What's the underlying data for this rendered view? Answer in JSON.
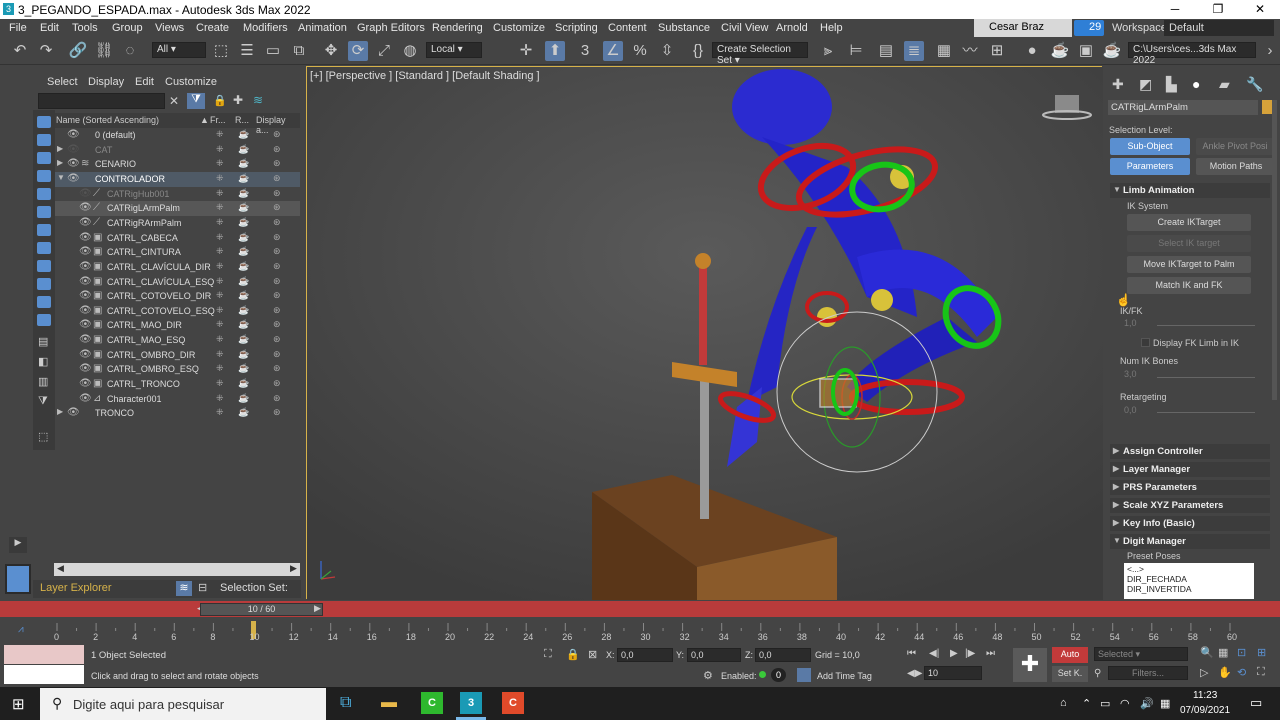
{
  "window": {
    "title": "3_PEGANDO_ESPADA.max - Autodesk 3ds Max 2022"
  },
  "menu": [
    "File",
    "Edit",
    "Tools",
    "Group",
    "Views",
    "Create",
    "Modifiers",
    "Animation",
    "Graph Editors",
    "Rendering",
    "Customize",
    "Scripting",
    "Content",
    "Substance",
    "Civil View",
    "Arnold",
    "Help"
  ],
  "account": {
    "user": "Cesar Braz",
    "badge": "29",
    "workspaces_label": "Workspaces:",
    "workspace": "Default"
  },
  "toolbar": {
    "filter": "All",
    "coord": "Local",
    "selection_set": "Create Selection Set",
    "path": "C:\\Users\\ces...3ds Max 2022"
  },
  "explorer": {
    "tabs": [
      "Select",
      "Display",
      "Edit",
      "Customize"
    ],
    "columns": {
      "name": "Name (Sorted Ascending)",
      "fr": "Fr...",
      "r": "R...",
      "display": "Display a..."
    },
    "rows": [
      {
        "name": "0 (default)"
      },
      {
        "name": "CAT"
      },
      {
        "name": "CENARIO"
      },
      {
        "name": "CONTROLADOR"
      },
      {
        "name": "CATRigHub001"
      },
      {
        "name": "CATRigLArmPalm"
      },
      {
        "name": "CATRigRArmPalm"
      },
      {
        "name": "CATRL_CABECA"
      },
      {
        "name": "CATRL_CINTURA"
      },
      {
        "name": "CATRL_CLAVÍCULA_DIR"
      },
      {
        "name": "CATRL_CLAVÍCULA_ESQ"
      },
      {
        "name": "CATRL_COTOVELO_DIR"
      },
      {
        "name": "CATRL_COTOVELO_ESQ"
      },
      {
        "name": "CATRL_MAO_DIR"
      },
      {
        "name": "CATRL_MAO_ESQ"
      },
      {
        "name": "CATRL_OMBRO_DIR"
      },
      {
        "name": "CATRL_OMBRO_ESQ"
      },
      {
        "name": "CATRL_TRONCO"
      },
      {
        "name": "Character001"
      },
      {
        "name": "TRONCO"
      }
    ],
    "layer_explorer": "Layer Explorer",
    "selection_set": "Selection Set:"
  },
  "viewport": {
    "label": "[+] [Perspective ] [Standard ] [Default Shading ]"
  },
  "cmd": {
    "object_name": "CATRigLArmPalm",
    "selection_level": "Selection Level:",
    "sub_object": "Sub-Object",
    "ankle_pivot": "Ankle Pivot Posi",
    "parameters": "Parameters",
    "motion_paths": "Motion Paths",
    "limb_animation": "Limb Animation",
    "ik_system": "IK System",
    "create_iktarget": "Create IKTarget",
    "select_iktarget": "Select IK target",
    "move_iktarget": "Move IKTarget to Palm",
    "match_ik_fk": "Match IK and FK",
    "ikfk": "IK/FK",
    "ikfk_val": "1,0",
    "display_fk": "Display FK Limb in IK",
    "num_ik_bones": "Num IK Bones",
    "num_ik_val": "3,0",
    "retargeting": "Retargeting",
    "retarget_val": "0,0",
    "rollouts": [
      "Assign Controller",
      "Layer Manager",
      "PRS Parameters",
      "Scale XYZ Parameters",
      "Key Info (Basic)",
      "Digit Manager"
    ],
    "preset_poses": "Preset Poses",
    "poses": [
      "<...>",
      "DIR_FECHADA",
      "DIR_INVERTIDA"
    ]
  },
  "timeline": {
    "frame": "10 / 60",
    "ticks": [
      "0",
      "2",
      "4",
      "6",
      "8",
      "10",
      "12",
      "14",
      "16",
      "18",
      "20",
      "22",
      "24",
      "26",
      "28",
      "30",
      "32",
      "34",
      "36",
      "38",
      "40",
      "42",
      "44",
      "46",
      "48",
      "50",
      "52",
      "54",
      "56",
      "58",
      "60"
    ]
  },
  "status": {
    "selected": "1 Object Selected",
    "hint": "Click and drag to select and rotate objects",
    "x_label": "X:",
    "x": "0,0",
    "y_label": "Y:",
    "y": "0,0",
    "z_label": "Z:",
    "z": "0,0",
    "grid": "Grid = 10,0",
    "enabled": "Enabled:",
    "add_time_tag": "Add Time Tag",
    "auto": "Auto",
    "selected_dd": "Selected",
    "setk": "Set K.",
    "filters": "Filters...",
    "frame_field": "10",
    "keyframe": "0"
  },
  "taskbar": {
    "search": "Digite aqui para pesquisar",
    "time": "11:23",
    "date": "07/09/2021"
  },
  "colors": {
    "accent": "#5a8fd0",
    "timebar": "#b93b3b",
    "selection": "#d6b24a"
  }
}
